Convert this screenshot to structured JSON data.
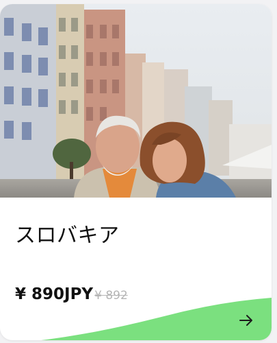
{
  "card": {
    "title": "スロバキア",
    "price": "¥ 890JPY",
    "original_price": "¥ 892",
    "image_alt": "Elderly couple looking at a map in an old European town street",
    "accent_color": "#7be07f",
    "action_icon": "arrow-right-icon"
  }
}
